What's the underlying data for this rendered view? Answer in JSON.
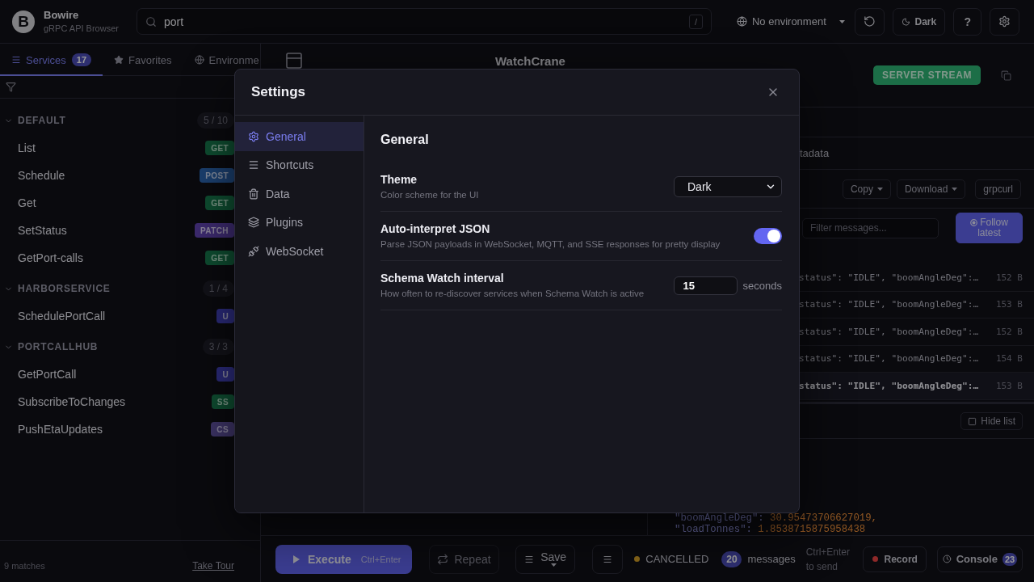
{
  "app": {
    "logo": "B",
    "name": "Bowire",
    "tagline": "gRPC API Browser"
  },
  "search": {
    "value": "port",
    "shortcut": "/"
  },
  "header_actions": {
    "environment": "No environment",
    "theme": "Dark",
    "help": "?"
  },
  "sidebar": {
    "tabs": [
      {
        "label": "Services",
        "badge": "17",
        "selected": true
      },
      {
        "label": "Favorites",
        "selected": false
      },
      {
        "label": "Environme",
        "selected": false
      }
    ],
    "groups": [
      {
        "name": "DEFAULT",
        "count": "5 / 10",
        "expanded": true,
        "items": [
          {
            "name": "List",
            "method": {
              "label": "GET",
              "kind": "get"
            }
          },
          {
            "name": "Schedule",
            "method": {
              "label": "POST",
              "kind": "post"
            }
          },
          {
            "name": "Get",
            "method": {
              "label": "GET",
              "kind": "get"
            }
          },
          {
            "name": "SetStatus",
            "method": {
              "label": "PATCH",
              "kind": "patch"
            }
          },
          {
            "name": "GetPort-calls",
            "method": {
              "label": "GET",
              "kind": "get"
            }
          }
        ]
      },
      {
        "name": "HARBORSERVICE",
        "count": "1 / 4",
        "expanded": true,
        "items": [
          {
            "name": "SchedulePortCall",
            "method": {
              "label": "U",
              "kind": "unary"
            }
          }
        ]
      },
      {
        "name": "PORTCALLHUB",
        "count": "3 / 3",
        "expanded": true,
        "items": [
          {
            "name": "GetPortCall",
            "method": {
              "label": "U",
              "kind": "unary"
            }
          },
          {
            "name": "SubscribeToChanges",
            "method": {
              "label": "SS",
              "kind": "server_stream"
            }
          },
          {
            "name": "PushEtaUpdates",
            "method": {
              "label": "CS",
              "kind": "client_stream"
            }
          }
        ]
      }
    ],
    "footer": {
      "matches": "9 matches",
      "link": "Take Tour"
    }
  },
  "method_view": {
    "title": "WatchCrane",
    "stream_type": "SERVER STREAM",
    "tab_fragment": "tadata",
    "actions": [
      {
        "label": "Copy",
        "dropdown": true
      },
      {
        "label": "Download",
        "dropdown": true
      },
      {
        "label": "grpcurl",
        "dropdown": false
      }
    ],
    "filter": {
      "placeholder": "Filter messages..."
    },
    "follow": {
      "label": "Follow latest",
      "on": true
    },
    "messages": [
      {
        "preview": "status\": \"IDLE\", \"boomAngleDeg\":…",
        "size": "152 B",
        "selected": false
      },
      {
        "preview": "status\": \"IDLE\", \"boomAngleDeg\":…",
        "size": "153 B",
        "selected": false
      },
      {
        "preview": "status\": \"IDLE\", \"boomAngleDeg\":…",
        "size": "152 B",
        "selected": false
      },
      {
        "preview": "status\": \"IDLE\", \"boomAngleDeg\":…",
        "size": "154 B",
        "selected": false
      },
      {
        "preview": "status\": \"IDLE\", \"boomAngleDeg\":…",
        "size": "153 B",
        "selected": true
      }
    ],
    "hide_list": "Hide list",
    "response_lines": [
      {
        "key": "\"boomAngleDeg\":",
        "value": "30.95473706627019,"
      },
      {
        "key": "\"loadTonnes\":",
        "value": "1.8538715875958438"
      }
    ]
  },
  "bottom_bar": {
    "execute": {
      "label": "Execute",
      "shortcut": "Ctrl+Enter"
    },
    "repeat": {
      "label": "Repeat",
      "disabled": true
    },
    "save": {
      "label": "Save"
    },
    "status": {
      "kind": "cancelled",
      "label": "CANCELLED"
    },
    "message_count": "20",
    "message_label": "messages",
    "send_hint": "Ctrl+Enter to send",
    "record": {
      "label": "Record"
    },
    "console": {
      "label": "Console",
      "count": "23"
    }
  },
  "settings": {
    "title": "Settings",
    "nav": [
      {
        "label": "General",
        "selected": true
      },
      {
        "label": "Shortcuts",
        "selected": false
      },
      {
        "label": "Data",
        "selected": false
      },
      {
        "label": "Plugins",
        "selected": false
      },
      {
        "label": "WebSocket",
        "selected": false
      }
    ],
    "section_title": "General",
    "rows": [
      {
        "kind": "select",
        "label": "Theme",
        "description": "Color scheme for the UI",
        "value": "Dark"
      },
      {
        "kind": "toggle",
        "label": "Auto-interpret JSON",
        "description": "Parse JSON payloads in WebSocket, MQTT, and SSE responses for pretty display",
        "on": true
      },
      {
        "kind": "number",
        "label": "Schema Watch interval",
        "description": "How often to re-discover services when Schema Watch is active",
        "value": "15",
        "unit": "seconds"
      }
    ]
  }
}
